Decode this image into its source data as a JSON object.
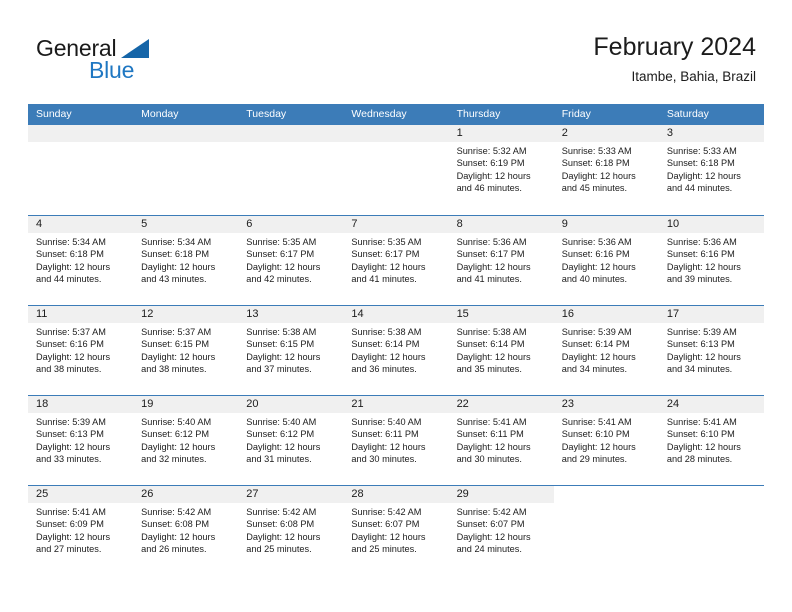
{
  "brand": {
    "name_part1": "General",
    "name_part2": "Blue",
    "triangle_color": "#1565a8",
    "blue_color": "#1f77c2"
  },
  "header": {
    "title": "February 2024",
    "location": "Itambe, Bahia, Brazil"
  },
  "calendar": {
    "header_bg": "#3c7cb8",
    "day_band_bg": "#f0f0f0",
    "weekdays": [
      "Sunday",
      "Monday",
      "Tuesday",
      "Wednesday",
      "Thursday",
      "Friday",
      "Saturday"
    ],
    "weeks": [
      [
        {
          "day": "",
          "sunrise": "",
          "sunset": "",
          "daylight_line1": "",
          "daylight_line2": ""
        },
        {
          "day": "",
          "sunrise": "",
          "sunset": "",
          "daylight_line1": "",
          "daylight_line2": ""
        },
        {
          "day": "",
          "sunrise": "",
          "sunset": "",
          "daylight_line1": "",
          "daylight_line2": ""
        },
        {
          "day": "",
          "sunrise": "",
          "sunset": "",
          "daylight_line1": "",
          "daylight_line2": ""
        },
        {
          "day": "1",
          "sunrise": "Sunrise: 5:32 AM",
          "sunset": "Sunset: 6:19 PM",
          "daylight_line1": "Daylight: 12 hours",
          "daylight_line2": "and 46 minutes."
        },
        {
          "day": "2",
          "sunrise": "Sunrise: 5:33 AM",
          "sunset": "Sunset: 6:18 PM",
          "daylight_line1": "Daylight: 12 hours",
          "daylight_line2": "and 45 minutes."
        },
        {
          "day": "3",
          "sunrise": "Sunrise: 5:33 AM",
          "sunset": "Sunset: 6:18 PM",
          "daylight_line1": "Daylight: 12 hours",
          "daylight_line2": "and 44 minutes."
        }
      ],
      [
        {
          "day": "4",
          "sunrise": "Sunrise: 5:34 AM",
          "sunset": "Sunset: 6:18 PM",
          "daylight_line1": "Daylight: 12 hours",
          "daylight_line2": "and 44 minutes."
        },
        {
          "day": "5",
          "sunrise": "Sunrise: 5:34 AM",
          "sunset": "Sunset: 6:18 PM",
          "daylight_line1": "Daylight: 12 hours",
          "daylight_line2": "and 43 minutes."
        },
        {
          "day": "6",
          "sunrise": "Sunrise: 5:35 AM",
          "sunset": "Sunset: 6:17 PM",
          "daylight_line1": "Daylight: 12 hours",
          "daylight_line2": "and 42 minutes."
        },
        {
          "day": "7",
          "sunrise": "Sunrise: 5:35 AM",
          "sunset": "Sunset: 6:17 PM",
          "daylight_line1": "Daylight: 12 hours",
          "daylight_line2": "and 41 minutes."
        },
        {
          "day": "8",
          "sunrise": "Sunrise: 5:36 AM",
          "sunset": "Sunset: 6:17 PM",
          "daylight_line1": "Daylight: 12 hours",
          "daylight_line2": "and 41 minutes."
        },
        {
          "day": "9",
          "sunrise": "Sunrise: 5:36 AM",
          "sunset": "Sunset: 6:16 PM",
          "daylight_line1": "Daylight: 12 hours",
          "daylight_line2": "and 40 minutes."
        },
        {
          "day": "10",
          "sunrise": "Sunrise: 5:36 AM",
          "sunset": "Sunset: 6:16 PM",
          "daylight_line1": "Daylight: 12 hours",
          "daylight_line2": "and 39 minutes."
        }
      ],
      [
        {
          "day": "11",
          "sunrise": "Sunrise: 5:37 AM",
          "sunset": "Sunset: 6:16 PM",
          "daylight_line1": "Daylight: 12 hours",
          "daylight_line2": "and 38 minutes."
        },
        {
          "day": "12",
          "sunrise": "Sunrise: 5:37 AM",
          "sunset": "Sunset: 6:15 PM",
          "daylight_line1": "Daylight: 12 hours",
          "daylight_line2": "and 38 minutes."
        },
        {
          "day": "13",
          "sunrise": "Sunrise: 5:38 AM",
          "sunset": "Sunset: 6:15 PM",
          "daylight_line1": "Daylight: 12 hours",
          "daylight_line2": "and 37 minutes."
        },
        {
          "day": "14",
          "sunrise": "Sunrise: 5:38 AM",
          "sunset": "Sunset: 6:14 PM",
          "daylight_line1": "Daylight: 12 hours",
          "daylight_line2": "and 36 minutes."
        },
        {
          "day": "15",
          "sunrise": "Sunrise: 5:38 AM",
          "sunset": "Sunset: 6:14 PM",
          "daylight_line1": "Daylight: 12 hours",
          "daylight_line2": "and 35 minutes."
        },
        {
          "day": "16",
          "sunrise": "Sunrise: 5:39 AM",
          "sunset": "Sunset: 6:14 PM",
          "daylight_line1": "Daylight: 12 hours",
          "daylight_line2": "and 34 minutes."
        },
        {
          "day": "17",
          "sunrise": "Sunrise: 5:39 AM",
          "sunset": "Sunset: 6:13 PM",
          "daylight_line1": "Daylight: 12 hours",
          "daylight_line2": "and 34 minutes."
        }
      ],
      [
        {
          "day": "18",
          "sunrise": "Sunrise: 5:39 AM",
          "sunset": "Sunset: 6:13 PM",
          "daylight_line1": "Daylight: 12 hours",
          "daylight_line2": "and 33 minutes."
        },
        {
          "day": "19",
          "sunrise": "Sunrise: 5:40 AM",
          "sunset": "Sunset: 6:12 PM",
          "daylight_line1": "Daylight: 12 hours",
          "daylight_line2": "and 32 minutes."
        },
        {
          "day": "20",
          "sunrise": "Sunrise: 5:40 AM",
          "sunset": "Sunset: 6:12 PM",
          "daylight_line1": "Daylight: 12 hours",
          "daylight_line2": "and 31 minutes."
        },
        {
          "day": "21",
          "sunrise": "Sunrise: 5:40 AM",
          "sunset": "Sunset: 6:11 PM",
          "daylight_line1": "Daylight: 12 hours",
          "daylight_line2": "and 30 minutes."
        },
        {
          "day": "22",
          "sunrise": "Sunrise: 5:41 AM",
          "sunset": "Sunset: 6:11 PM",
          "daylight_line1": "Daylight: 12 hours",
          "daylight_line2": "and 30 minutes."
        },
        {
          "day": "23",
          "sunrise": "Sunrise: 5:41 AM",
          "sunset": "Sunset: 6:10 PM",
          "daylight_line1": "Daylight: 12 hours",
          "daylight_line2": "and 29 minutes."
        },
        {
          "day": "24",
          "sunrise": "Sunrise: 5:41 AM",
          "sunset": "Sunset: 6:10 PM",
          "daylight_line1": "Daylight: 12 hours",
          "daylight_line2": "and 28 minutes."
        }
      ],
      [
        {
          "day": "25",
          "sunrise": "Sunrise: 5:41 AM",
          "sunset": "Sunset: 6:09 PM",
          "daylight_line1": "Daylight: 12 hours",
          "daylight_line2": "and 27 minutes."
        },
        {
          "day": "26",
          "sunrise": "Sunrise: 5:42 AM",
          "sunset": "Sunset: 6:08 PM",
          "daylight_line1": "Daylight: 12 hours",
          "daylight_line2": "and 26 minutes."
        },
        {
          "day": "27",
          "sunrise": "Sunrise: 5:42 AM",
          "sunset": "Sunset: 6:08 PM",
          "daylight_line1": "Daylight: 12 hours",
          "daylight_line2": "and 25 minutes."
        },
        {
          "day": "28",
          "sunrise": "Sunrise: 5:42 AM",
          "sunset": "Sunset: 6:07 PM",
          "daylight_line1": "Daylight: 12 hours",
          "daylight_line2": "and 25 minutes."
        },
        {
          "day": "29",
          "sunrise": "Sunrise: 5:42 AM",
          "sunset": "Sunset: 6:07 PM",
          "daylight_line1": "Daylight: 12 hours",
          "daylight_line2": "and 24 minutes."
        },
        {
          "day": "",
          "sunrise": "",
          "sunset": "",
          "daylight_line1": "",
          "daylight_line2": ""
        },
        {
          "day": "",
          "sunrise": "",
          "sunset": "",
          "daylight_line1": "",
          "daylight_line2": ""
        }
      ]
    ]
  }
}
